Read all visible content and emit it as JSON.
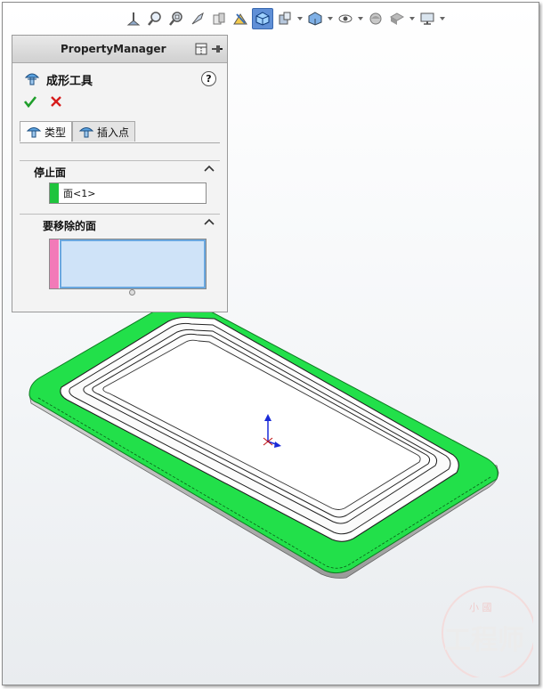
{
  "property_manager": {
    "title": "PropertyManager",
    "feature_name": "成形工具",
    "help_label": "?",
    "tabs": [
      {
        "label": "类型",
        "selected": true
      },
      {
        "label": "插入点",
        "selected": false
      }
    ],
    "stop_face": {
      "title": "停止面",
      "value": "面<1>",
      "swatch_color": "#1ec43d"
    },
    "remove_faces": {
      "title": "要移除的面",
      "value": "",
      "swatch_color": "#f27ab8"
    }
  },
  "toolbar": {
    "icons": [
      "view-orientation-icon",
      "zoom-to-fit-icon",
      "zoom-to-area-icon",
      "previous-view-icon",
      "section-view-icon",
      "dynamic-annotation-icon",
      "standard-views-icon",
      "display-style-icon",
      "hide-show-icon",
      "edit-appearance-icon",
      "apply-scene-icon",
      "view-settings-icon"
    ],
    "active_icon": "standard-views-icon"
  },
  "colors": {
    "face_highlight": "#22e04a",
    "accent": "#5f8fd6"
  },
  "watermark": {
    "text": "工程师",
    "small_text": "小 國"
  }
}
